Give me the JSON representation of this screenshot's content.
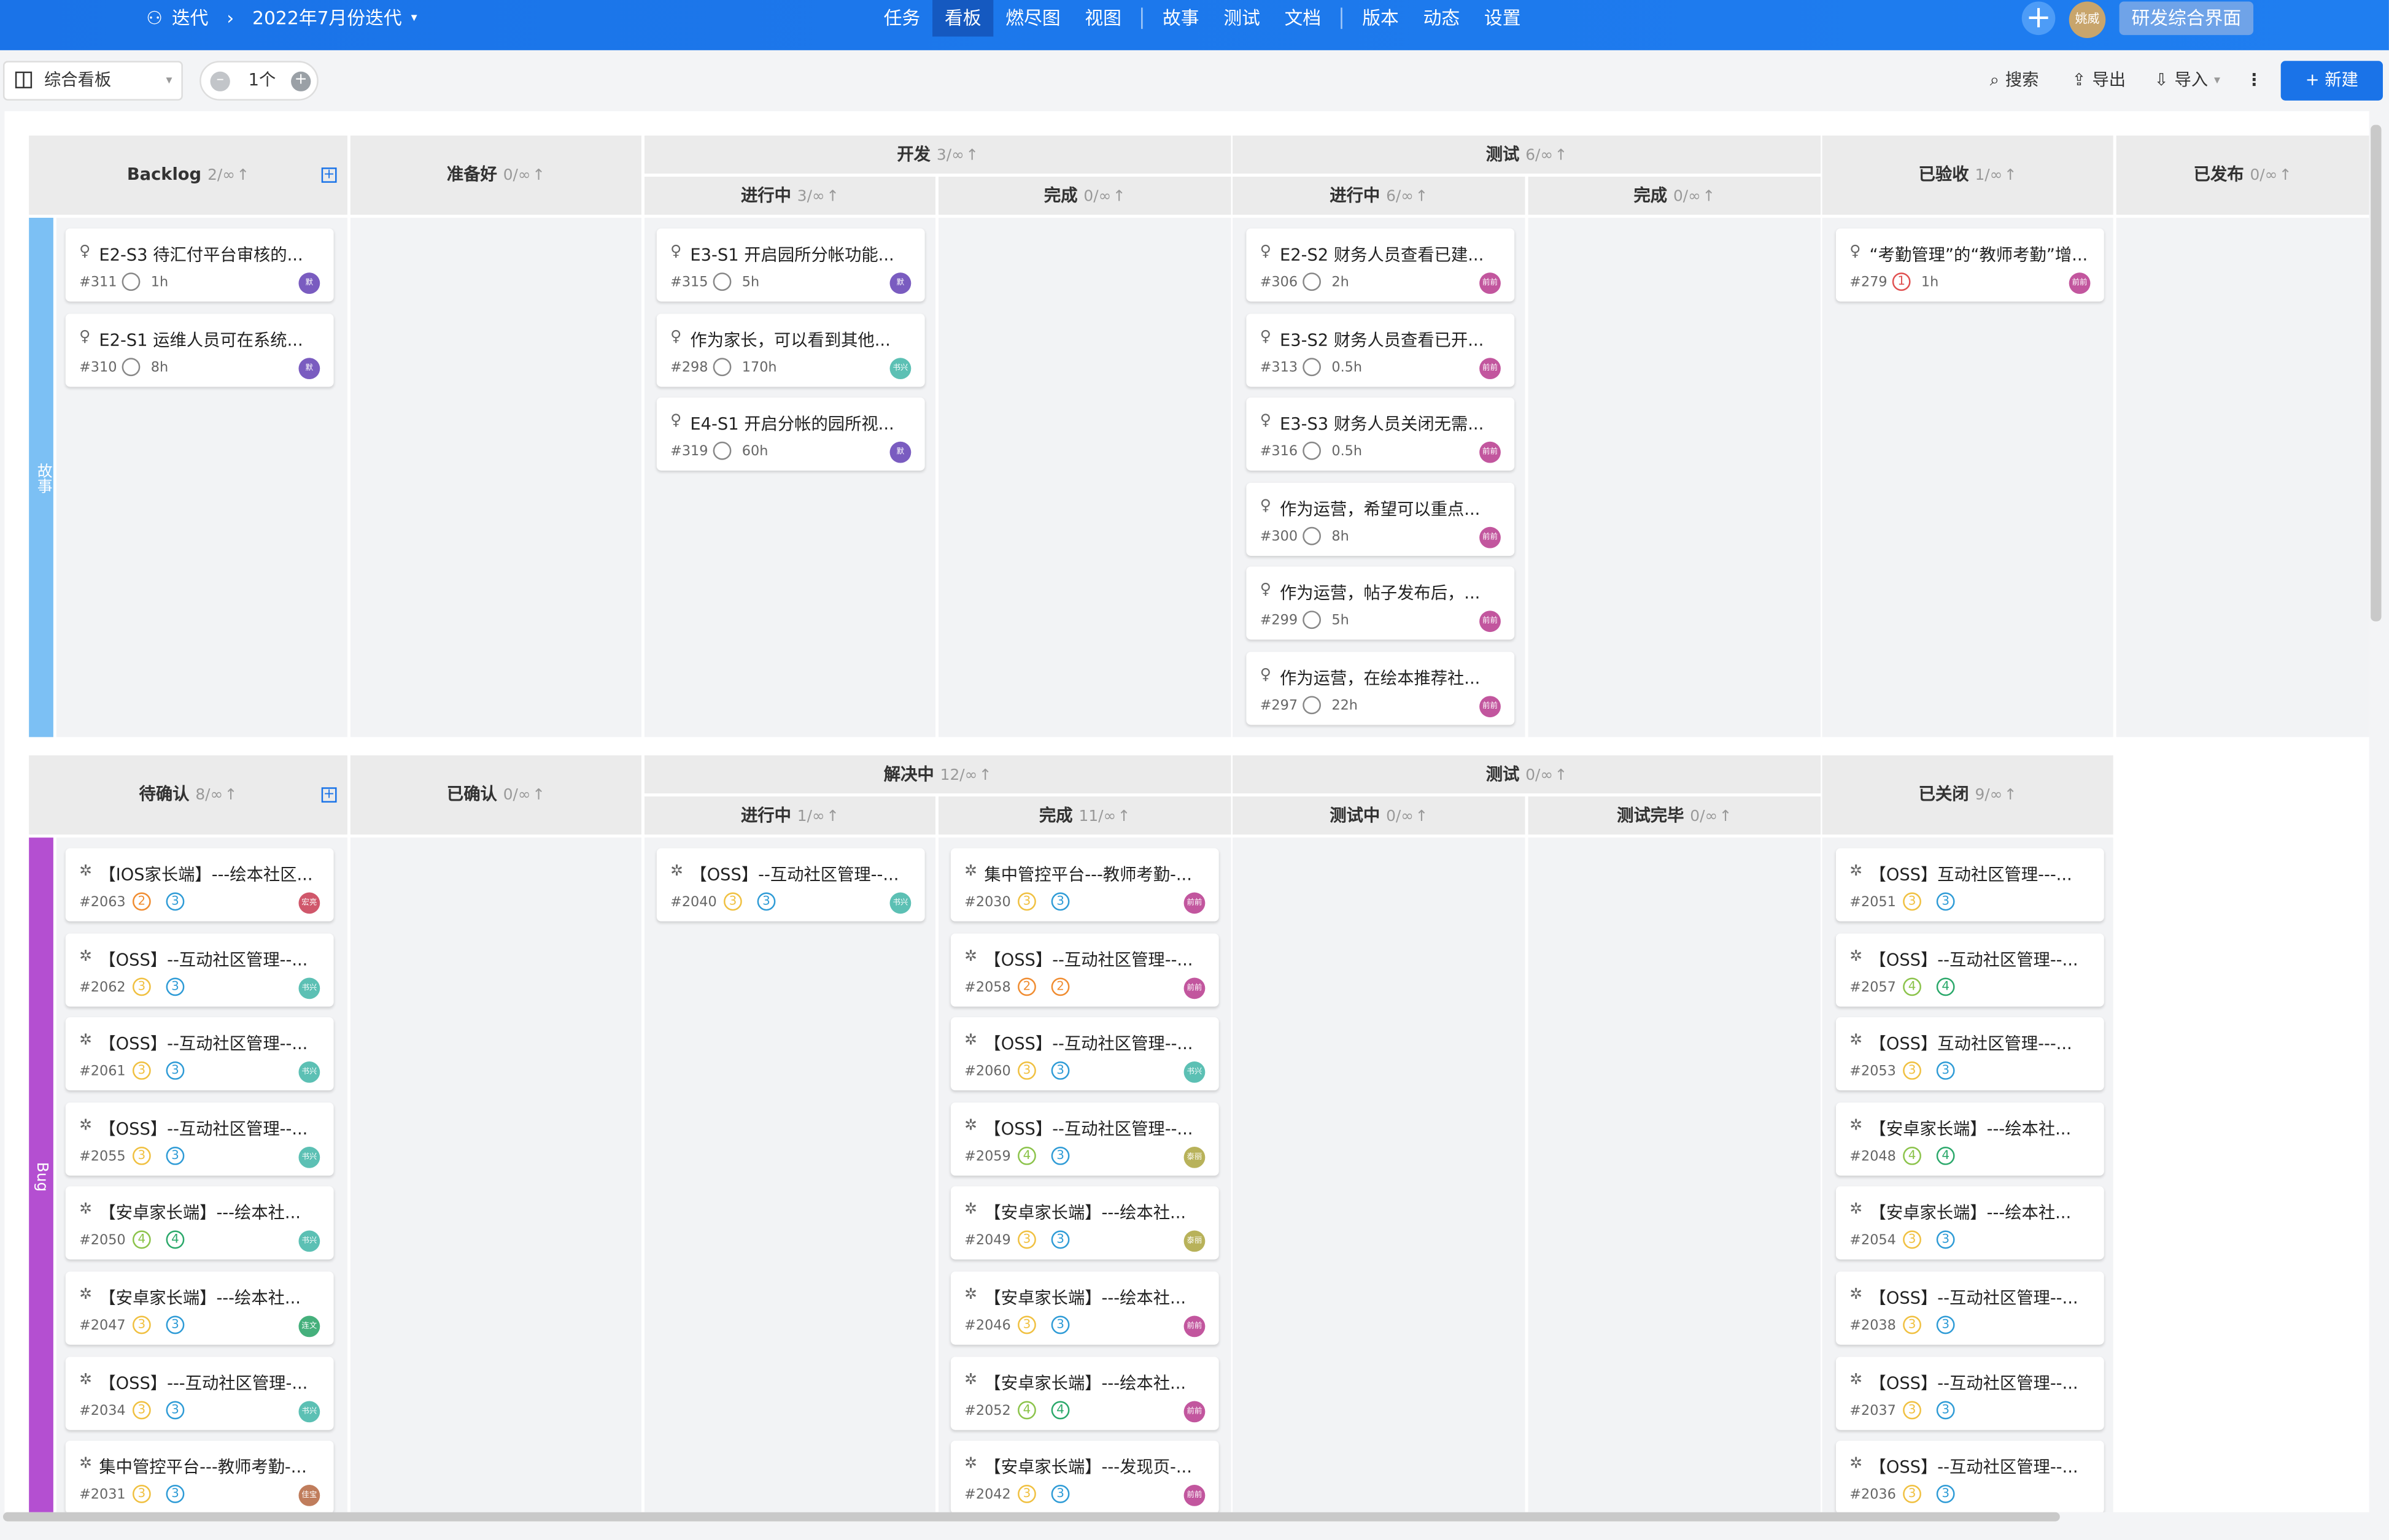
{
  "topbar": {
    "breadcrumb": {
      "iteration": "迭代",
      "current": "2022年7月份迭代"
    },
    "nav": [
      "任务",
      "看板",
      "燃尽图",
      "视图",
      "故事",
      "测试",
      "文档",
      "版本",
      "动态",
      "设置"
    ],
    "active_nav": "看板",
    "user_name": "姚威",
    "project_button": "研发综合界面"
  },
  "toolbar": {
    "board_name": "综合看板",
    "count_label": "1个",
    "search": "搜索",
    "export": "导出",
    "import": "导入",
    "new": "+ 新建"
  },
  "stories": {
    "lane_label": "故事",
    "lane_color": "#7cc0f4",
    "headers": {
      "backlog": {
        "name": "Backlog",
        "limit": "2/∞"
      },
      "ready": {
        "name": "准备好",
        "limit": "0/∞"
      },
      "dev": {
        "name": "开发",
        "limit": "3/∞"
      },
      "dev_doing": {
        "name": "进行中",
        "limit": "3/∞"
      },
      "dev_done": {
        "name": "完成",
        "limit": "0/∞"
      },
      "test": {
        "name": "测试",
        "limit": "6/∞"
      },
      "test_doing": {
        "name": "进行中",
        "limit": "6/∞"
      },
      "test_done": {
        "name": "完成",
        "limit": "0/∞"
      },
      "accepted": {
        "name": "已验收",
        "limit": "1/∞"
      },
      "released": {
        "name": "已发布",
        "limit": "0/∞"
      }
    },
    "cards": [
      {
        "col": 0,
        "title": "E2-S3 待汇付平台审核的...",
        "id": "#311",
        "est": "1h",
        "av": "默",
        "avc": "#7a5cc0"
      },
      {
        "col": 0,
        "title": "E2-S1 运维人员可在系统...",
        "id": "#310",
        "est": "8h",
        "av": "默",
        "avc": "#7a5cc0"
      },
      {
        "col": 2,
        "title": "E3-S1 开启园所分帐功能...",
        "id": "#315",
        "est": "5h",
        "av": "默",
        "avc": "#7a5cc0"
      },
      {
        "col": 2,
        "title": "作为家长，可以看到其他...",
        "id": "#298",
        "est": "170h",
        "av": "书兴",
        "avc": "#5cc0b4"
      },
      {
        "col": 2,
        "title": "E4-S1 开启分帐的园所视...",
        "id": "#319",
        "est": "60h",
        "av": "默",
        "avc": "#7a5cc0"
      },
      {
        "col": 4,
        "title": "E2-S2 财务人员查看已建...",
        "id": "#306",
        "est": "2h",
        "av": "前前",
        "avc": "#c2569e"
      },
      {
        "col": 4,
        "title": "E3-S2 财务人员查看已开...",
        "id": "#313",
        "est": "0.5h",
        "av": "前前",
        "avc": "#c2569e"
      },
      {
        "col": 4,
        "title": "E3-S3 财务人员关闭无需...",
        "id": "#316",
        "est": "0.5h",
        "av": "前前",
        "avc": "#c2569e"
      },
      {
        "col": 4,
        "title": "作为运营，希望可以重点...",
        "id": "#300",
        "est": "8h",
        "av": "前前",
        "avc": "#c2569e"
      },
      {
        "col": 4,
        "title": "作为运营，帖子发布后，...",
        "id": "#299",
        "est": "5h",
        "av": "前前",
        "avc": "#c2569e"
      },
      {
        "col": 4,
        "title": "作为运营，在绘本推荐社...",
        "id": "#297",
        "est": "22h",
        "av": "前前",
        "avc": "#c2569e"
      },
      {
        "col": 6,
        "title": "“考勤管理”的“教师考勤”增...",
        "id": "#279",
        "est": "1h",
        "av": "前前",
        "avc": "#c2569e",
        "flag": "1"
      }
    ]
  },
  "bugs": {
    "lane_label": "Bug",
    "lane_color": "#b44fd1",
    "headers": {
      "pending": {
        "name": "待确认",
        "limit": "8/∞"
      },
      "confirmed": {
        "name": "已确认",
        "limit": "0/∞"
      },
      "resolving": {
        "name": "解决中",
        "limit": "12/∞"
      },
      "res_doing": {
        "name": "进行中",
        "limit": "1/∞"
      },
      "res_done": {
        "name": "完成",
        "limit": "11/∞"
      },
      "test": {
        "name": "测试",
        "limit": "0/∞"
      },
      "test_doing": {
        "name": "测试中",
        "limit": "0/∞"
      },
      "test_done": {
        "name": "测试完毕",
        "limit": "0/∞"
      },
      "closed": {
        "name": "已关闭",
        "limit": "9/∞"
      }
    },
    "cards": [
      {
        "col": 0,
        "title": "【IOS家长端】---绘本社区...",
        "id": "#2063",
        "p": "2",
        "s": "3",
        "av": "宏亮",
        "avc": "#d0576b"
      },
      {
        "col": 0,
        "title": "【OSS】--互动社区管理--...",
        "id": "#2062",
        "p": "3",
        "s": "3",
        "av": "书兴",
        "avc": "#5cc0b4"
      },
      {
        "col": 0,
        "title": "【OSS】--互动社区管理--...",
        "id": "#2061",
        "p": "3",
        "s": "3",
        "av": "书兴",
        "avc": "#5cc0b4"
      },
      {
        "col": 0,
        "title": "【OSS】--互动社区管理--...",
        "id": "#2055",
        "p": "3",
        "s": "3",
        "av": "书兴",
        "avc": "#5cc0b4"
      },
      {
        "col": 0,
        "title": "【安卓家长端】---绘本社...",
        "id": "#2050",
        "p": "4",
        "s": "4",
        "av": "书兴",
        "avc": "#5cc0b4"
      },
      {
        "col": 0,
        "title": "【安卓家长端】---绘本社...",
        "id": "#2047",
        "p": "3",
        "s": "3",
        "av": "连文",
        "avc": "#45b07c"
      },
      {
        "col": 0,
        "title": "【OSS】---互动社区管理-...",
        "id": "#2034",
        "p": "3",
        "s": "3",
        "av": "书兴",
        "avc": "#5cc0b4"
      },
      {
        "col": 0,
        "title": "集中管控平台---教师考勤-...",
        "id": "#2031",
        "p": "3",
        "s": "3",
        "av": "佳宝",
        "avc": "#c07d5c"
      },
      {
        "col": 2,
        "title": "【OSS】--互动社区管理--...",
        "id": "#2040",
        "p": "3",
        "s": "3",
        "av": "书兴",
        "avc": "#5cc0b4"
      },
      {
        "col": 3,
        "title": "集中管控平台---教师考勤-...",
        "id": "#2030",
        "p": "3",
        "s": "3",
        "av": "前前",
        "avc": "#c2569e"
      },
      {
        "col": 3,
        "title": "【OSS】--互动社区管理--...",
        "id": "#2058",
        "p": "2",
        "s": "2",
        "av": "前前",
        "avc": "#c2569e"
      },
      {
        "col": 3,
        "title": "【OSS】--互动社区管理--...",
        "id": "#2060",
        "p": "3",
        "s": "3",
        "av": "书兴",
        "avc": "#5cc0b4"
      },
      {
        "col": 3,
        "title": "【OSS】--互动社区管理--...",
        "id": "#2059",
        "p": "4",
        "s": "3",
        "av": "泰丽",
        "avc": "#b8b25a"
      },
      {
        "col": 3,
        "title": "【安卓家长端】---绘本社...",
        "id": "#2049",
        "p": "3",
        "s": "3",
        "av": "泰丽",
        "avc": "#b8b25a"
      },
      {
        "col": 3,
        "title": "【安卓家长端】---绘本社...",
        "id": "#2046",
        "p": "3",
        "s": "3",
        "av": "前前",
        "avc": "#c2569e"
      },
      {
        "col": 3,
        "title": "【安卓家长端】---绘本社...",
        "id": "#2052",
        "p": "4",
        "s": "4",
        "av": "前前",
        "avc": "#c2569e"
      },
      {
        "col": 3,
        "title": "【安卓家长端】---发现页-...",
        "id": "#2042",
        "p": "3",
        "s": "3",
        "av": "前前",
        "avc": "#c2569e"
      },
      {
        "col": 6,
        "title": "【OSS】互动社区管理---...",
        "id": "#2051",
        "p": "3",
        "s": "3",
        "av": "",
        "avc": ""
      },
      {
        "col": 6,
        "title": "【OSS】--互动社区管理--...",
        "id": "#2057",
        "p": "4",
        "s": "4",
        "av": "",
        "avc": ""
      },
      {
        "col": 6,
        "title": "【OSS】互动社区管理---...",
        "id": "#2053",
        "p": "3",
        "s": "3",
        "av": "",
        "avc": ""
      },
      {
        "col": 6,
        "title": "【安卓家长端】---绘本社...",
        "id": "#2048",
        "p": "4",
        "s": "4",
        "av": "",
        "avc": ""
      },
      {
        "col": 6,
        "title": "【安卓家长端】---绘本社...",
        "id": "#2054",
        "p": "3",
        "s": "3",
        "av": "",
        "avc": ""
      },
      {
        "col": 6,
        "title": "【OSS】--互动社区管理--...",
        "id": "#2038",
        "p": "3",
        "s": "3",
        "av": "",
        "avc": ""
      },
      {
        "col": 6,
        "title": "【OSS】--互动社区管理--...",
        "id": "#2037",
        "p": "3",
        "s": "3",
        "av": "",
        "avc": ""
      },
      {
        "col": 6,
        "title": "【OSS】--互动社区管理--...",
        "id": "#2036",
        "p": "3",
        "s": "3",
        "av": "",
        "avc": ""
      }
    ]
  },
  "colors": {
    "topbar": "#1a73e8",
    "accent": "#1a73e8",
    "priority": "#f0c040",
    "severity": "#2e9bd6",
    "urgent": "#e05050"
  }
}
